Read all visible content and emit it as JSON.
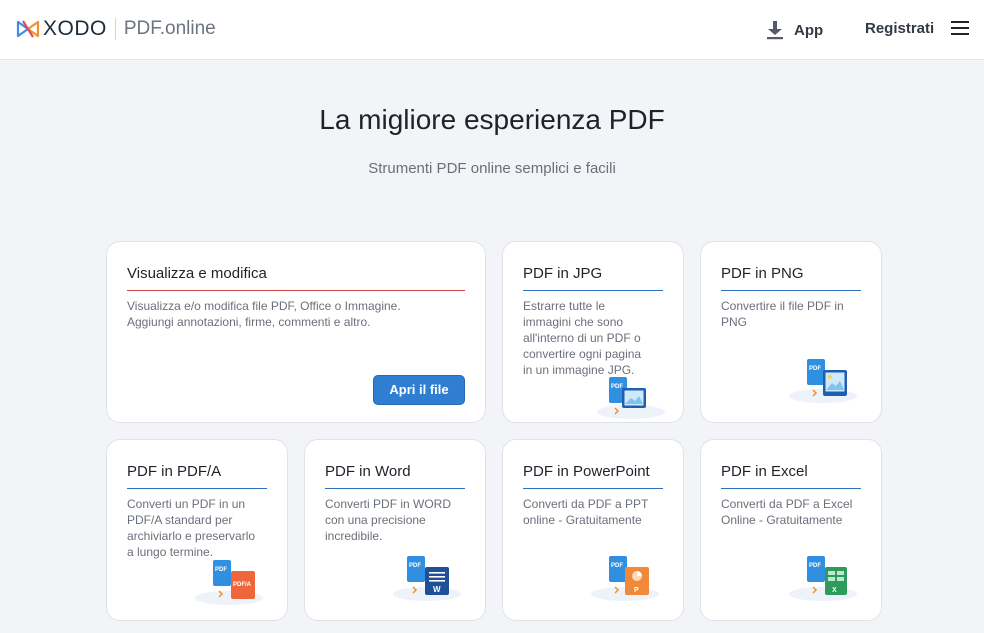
{
  "header": {
    "logo_text": "XODO",
    "logo_sub": "PDF.online",
    "app_label": "App",
    "register_label": "Registrati"
  },
  "hero": {
    "title": "La migliore esperienza PDF",
    "subtitle": "Strumenti PDF online semplici e facili"
  },
  "cards": [
    {
      "title": "Visualizza e modifica",
      "desc": [
        "Visualizza e/o modifica file PDF, Office o Immagine.",
        "Aggiungi annotazioni, firme, commenti e altro."
      ],
      "button": "Apri il file"
    },
    {
      "title": "PDF in JPG",
      "desc": [
        "Estrarre tutte le",
        "immagini che sono",
        "all'interno di un PDF o",
        "convertire ogni pagina",
        "in un immagine JPG."
      ],
      "icon": "pdf-to-jpg-icon"
    },
    {
      "title": "PDF in PNG",
      "desc": [
        "Convertire il file PDF in",
        "PNG"
      ],
      "icon": "pdf-to-png-icon"
    },
    {
      "title": "PDF in PDF/A",
      "desc": [
        "Converti un PDF in un",
        "PDF/A standard per",
        "archiviarlo e preservarlo",
        "a lungo termine."
      ],
      "icon": "pdf-to-pdfa-icon"
    },
    {
      "title": "PDF in Word",
      "desc": [
        "Converti PDF in WORD",
        "con una precisione",
        "incredibile."
      ],
      "icon": "pdf-to-word-icon"
    },
    {
      "title": "PDF in PowerPoint",
      "desc": [
        "Converti da PDF a PPT",
        "online - Gratuitamente"
      ],
      "icon": "pdf-to-ppt-icon"
    },
    {
      "title": "PDF in Excel",
      "desc": [
        "Converti da PDF a Excel",
        "Online - Gratuitamente"
      ],
      "icon": "pdf-to-excel-icon"
    }
  ],
  "icon_labels": {
    "pdf": "PDF",
    "pdfa": "PDF/A",
    "word": "W",
    "ppt": "P",
    "excel": "X"
  },
  "colors": {
    "accent": "#2f7ed1",
    "featured_line": "#d24545",
    "card_line": "#2f6fc0",
    "background": "#f2f4f7"
  }
}
